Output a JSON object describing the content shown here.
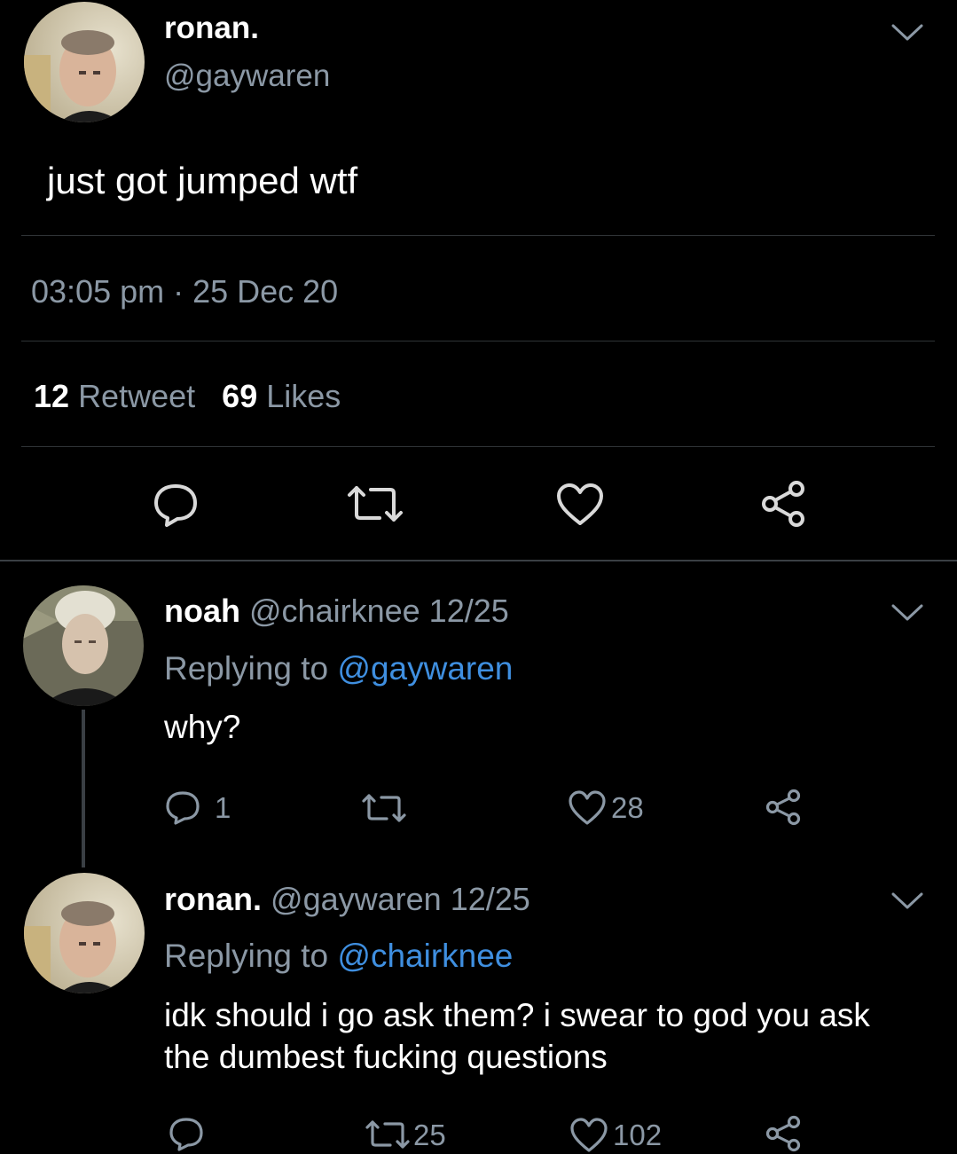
{
  "main_tweet": {
    "display_name": "ronan.",
    "handle": "@gaywaren",
    "text": "just got jumped wtf",
    "timestamp": "03:05 pm · 25 Dec 20",
    "retweet_count": "12",
    "retweet_label": "Retweet",
    "like_count": "69",
    "like_label": "Likes"
  },
  "replies": [
    {
      "display_name": "noah",
      "handle": "@chairknee",
      "date": "12/25",
      "replying_prefix": "Replying to",
      "replying_to": "@gaywaren",
      "text": "why?",
      "reply_count": "1",
      "retweet_count": "",
      "like_count": "28"
    },
    {
      "display_name": "ronan.",
      "handle": "@gaywaren",
      "date": "12/25",
      "replying_prefix": "Replying to",
      "replying_to": "@chairknee",
      "text_line1": "idk should i go ask them? i swear to god you ask",
      "text_line2": "the dumbest fucking questions",
      "reply_count": "",
      "retweet_count": "25",
      "like_count": "102"
    }
  ],
  "colors": {
    "background": "#000000",
    "text": "#ffffff",
    "muted": "#8b98a5",
    "link": "#3f8fe0",
    "divider": "#2f3336"
  }
}
